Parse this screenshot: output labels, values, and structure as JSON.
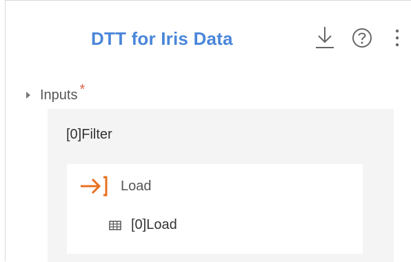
{
  "header": {
    "title": "DTT for Iris Data",
    "title_color": "#4a86d9",
    "icons": [
      "download-icon",
      "help-icon",
      "more-vertical-icon"
    ]
  },
  "inputs_section": {
    "label": "Inputs",
    "required_marker": "*",
    "required_color": "#e0604a",
    "expanded": false,
    "filter": {
      "label": "[0]Filter",
      "load": {
        "label": "Load",
        "icon": "load-arrow-icon",
        "icon_color": "#e8701f",
        "items": [
          {
            "label": "[0]Load",
            "icon": "table-icon"
          }
        ]
      }
    }
  }
}
